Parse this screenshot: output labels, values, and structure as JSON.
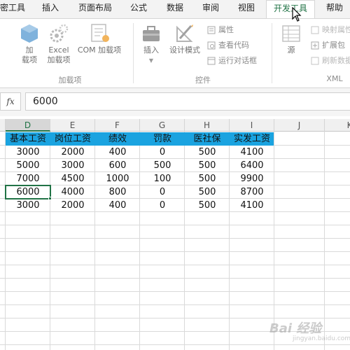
{
  "tabs": [
    {
      "label": "密工具",
      "active": false
    },
    {
      "label": "插入",
      "active": false
    },
    {
      "label": "页面布局",
      "active": false
    },
    {
      "label": "公式",
      "active": false
    },
    {
      "label": "数据",
      "active": false
    },
    {
      "label": "审阅",
      "active": false
    },
    {
      "label": "视图",
      "active": false
    },
    {
      "label": "开发工具",
      "active": true
    },
    {
      "label": "帮助",
      "active": false
    }
  ],
  "ribbon": {
    "addins": {
      "addin_line1": "加",
      "addin_line2": "载项",
      "excel_line1": "Excel",
      "excel_line2": "加载项",
      "com_label": "COM 加载项",
      "group_label": "加载项"
    },
    "controls": {
      "insert_label": "插入",
      "design_mode_label": "设计模式",
      "properties_label": "属性",
      "view_code_label": "查看代码",
      "run_dialog_label": "运行对话框",
      "group_label": "控件"
    },
    "xml": {
      "source_label": "源",
      "map_props_label": "映射属性",
      "expansion_pack_label": "扩展包",
      "refresh_data_label": "刷新数据",
      "group_label": "XML"
    }
  },
  "formula_bar": {
    "fx_label": "fx",
    "value": "6000"
  },
  "grid": {
    "columns": [
      "D",
      "E",
      "F",
      "G",
      "H",
      "I",
      "J",
      "K"
    ],
    "selected_column": "D",
    "headers": [
      "基本工资",
      "岗位工资",
      "绩效",
      "罚款",
      "医社保",
      "实发工资"
    ],
    "rows": [
      [
        "3000",
        "2000",
        "400",
        "0",
        "500",
        "4100"
      ],
      [
        "5000",
        "3000",
        "600",
        "500",
        "500",
        "6400"
      ],
      [
        "7000",
        "4500",
        "1000",
        "100",
        "500",
        "9900"
      ],
      [
        "6000",
        "4000",
        "800",
        "0",
        "500",
        "8700"
      ],
      [
        "3000",
        "2000",
        "400",
        "0",
        "500",
        "4100"
      ]
    ],
    "active_cell": "D5"
  },
  "colors": {
    "accent": "#217346",
    "header_band": "#1aa3e0"
  },
  "watermark": {
    "text": "Bai 经验",
    "sub": "jingyan.baidu.com"
  }
}
